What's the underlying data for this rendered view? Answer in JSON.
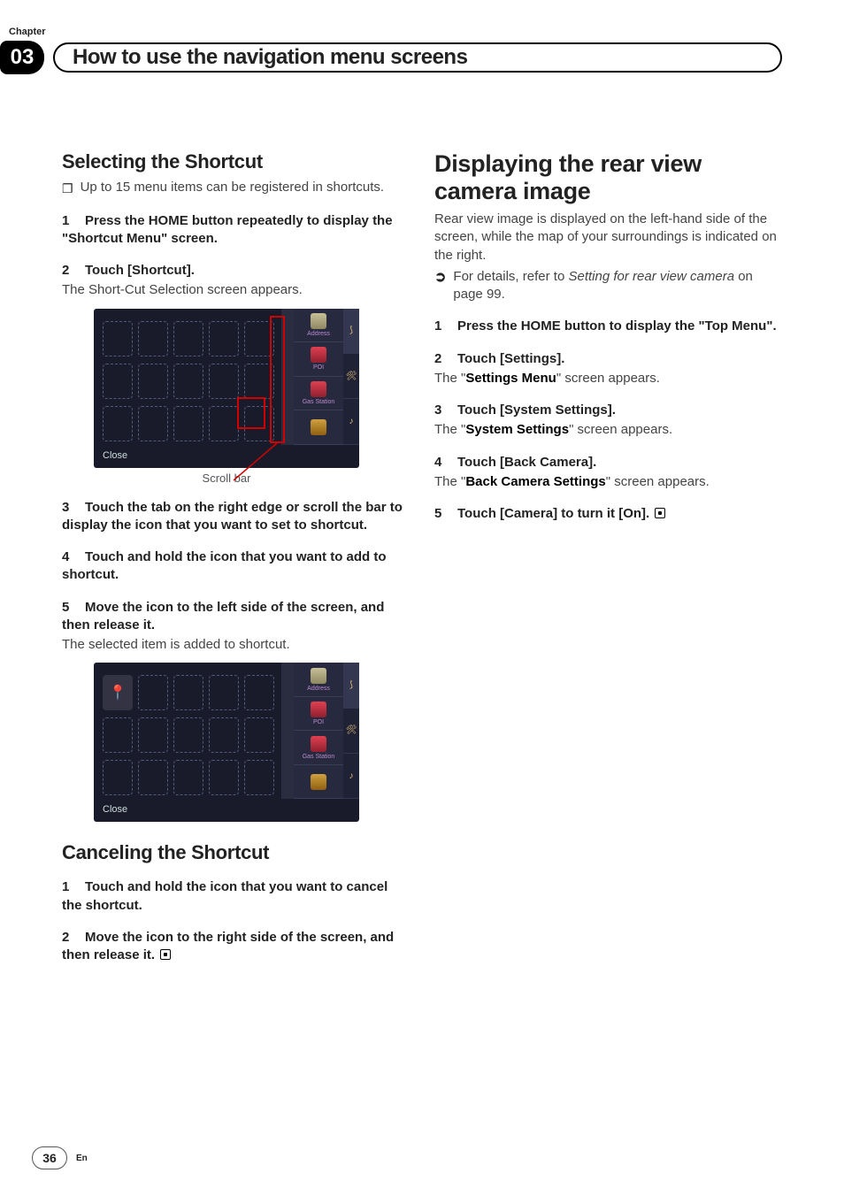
{
  "header": {
    "chapter_label": "Chapter",
    "chapter_number": "03",
    "title": "How to use the navigation menu screens"
  },
  "left_column": {
    "section_title": "Selecting the Shortcut",
    "note_bullet": "❐",
    "note_text": "Up to 15 menu items can be registered in shortcuts.",
    "step1_num": "1",
    "step1": "Press the HOME button repeatedly to display the \"Shortcut Menu\" screen.",
    "step2_num": "2",
    "step2": "Touch [Shortcut].",
    "step2_sub": "The Short-Cut Selection screen appears.",
    "screenshot1": {
      "right_labels": [
        "Address",
        "POI",
        "Gas Station",
        ""
      ],
      "close": "Close",
      "caption": "Scroll bar"
    },
    "step3_num": "3",
    "step3": "Touch the tab on the right edge or scroll the bar to display the icon that you want to set to shortcut.",
    "step4_num": "4",
    "step4": "Touch and hold the icon that you want to add to shortcut.",
    "step5_num": "5",
    "step5": "Move the icon to the left side of the screen, and then release it.",
    "step5_sub": "The selected item is added to shortcut.",
    "screenshot2": {
      "right_labels": [
        "Address",
        "POI",
        "Gas Station",
        ""
      ],
      "close": "Close"
    },
    "cancel_title": "Canceling the Shortcut",
    "cstep1_num": "1",
    "cstep1": "Touch and hold the icon that you want to cancel the shortcut.",
    "cstep2_num": "2",
    "cstep2": "Move the icon to the right side of the screen, and then release it."
  },
  "right_column": {
    "major_title": "Displaying the rear view camera image",
    "intro": "Rear view image is displayed on the left-hand side of the screen, while the map of your surroundings is indicated on the right.",
    "details_prefix": "For details, refer to ",
    "details_link": "Setting for rear view camera",
    "details_suffix": " on page 99.",
    "step1_num": "1",
    "step1": "Press the HOME button to display the \"Top Menu\".",
    "step2_num": "2",
    "step2": "Touch [Settings].",
    "step2_sub_prefix": "The \"",
    "step2_sub_strong": "Settings Menu",
    "step2_sub_suffix": "\" screen appears.",
    "step3_num": "3",
    "step3": "Touch [System Settings].",
    "step3_sub_prefix": "The \"",
    "step3_sub_strong": "System Settings",
    "step3_sub_suffix": "\" screen appears.",
    "step4_num": "4",
    "step4": "Touch [Back Camera].",
    "step4_sub_prefix": "The \"",
    "step4_sub_strong": "Back Camera Settings",
    "step4_sub_suffix": "\" screen appears.",
    "step5_num": "5",
    "step5": "Touch [Camera] to turn it [On]."
  },
  "footer": {
    "page_number": "36",
    "language": "En"
  }
}
